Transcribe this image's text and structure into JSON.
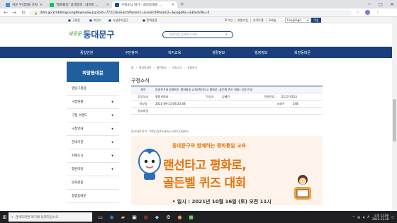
{
  "browser": {
    "tabs": [
      {
        "label": "쉬운 우리말을 쓰자",
        "color": "#4a8bd8"
      },
      {
        "label": "'평화통일' 검색결과 : 네이버 ...",
        "color": "#03c75a"
      },
      {
        "label": "구정소식 읽기 - 희망동대문 ...",
        "color": "#1c4f9c"
      }
    ],
    "new_tab": "+",
    "window_controls": [
      "─",
      "□",
      "✕"
    ],
    "url": "ddm.go.kr/ddm/guungNewsview.jsp?pId=77222&searchParam1=&searchParam2=&pageNo=&blockNo=0",
    "nav_icons": [
      "←",
      "→",
      "↻"
    ]
  },
  "site_util": {
    "left_links": [
      "구청장",
      "보건소",
      "시설관리공단",
      "문화관광"
    ],
    "right_links": [
      "로그인",
      "회원가입",
      "사이트맵",
      "모바일"
    ],
    "language": "Language",
    "go": "이동"
  },
  "header": {
    "logo_a": "새로운",
    "logo_b": "동대문구",
    "search_placeholder": "검색어를 입력해 주세요"
  },
  "gnb": [
    "종합민원",
    "구민참여",
    "복지교육",
    "생활정보",
    "행정정보",
    "희망동대문"
  ],
  "sidebar": {
    "title": "희망동대문",
    "items": [
      {
        "label": "열린구청장",
        "arrow": ""
      },
      {
        "label": "구정현황",
        "arrow": "▼"
      },
      {
        "label": "구정 브랜드",
        "arrow": "▼"
      },
      {
        "label": "구정안내",
        "arrow": "▼"
      },
      {
        "label": "관내기관",
        "arrow": "▼"
      },
      {
        "label": "자매도시",
        "arrow": "▼"
      },
      {
        "label": "열린마당",
        "arrow": "▼"
      },
      {
        "label": "문화관광",
        "arrow": ""
      },
      {
        "label": "청렴동대문",
        "arrow": ""
      }
    ]
  },
  "content": {
    "breadcrumb": [
      "홈",
      "희망동대문",
      "열린마당",
      "구정소식",
      "조회하기"
    ],
    "title": "구정소식",
    "detail": {
      "subject_label": "제목",
      "subject": "동대문구와 함께하는 평화통일 교육(랜선타고 평화로, 골든벨 퀴즈 대회) 신청 안내",
      "dept_label": "담당부서",
      "dept": "행정지원과",
      "author_label": "작성자",
      "author": "김혜진",
      "phone_label": "전화번호",
      "phone": "2127-4313",
      "date_label": "작성일",
      "date": "2021-09-13 09:23:48",
      "views_label": "조회수",
      "views": "248",
      "attach_label": "첨부파일"
    },
    "short_url_label": "링크바로가기 : http://pf.kakao.com/_Dqhhs",
    "poster": {
      "line1": "동대문구와 함께하는 평화통일 교육",
      "line2": "랜선타고 평화로,",
      "line3": "골든벨 퀴즈 대회",
      "line4": "• 일시 : 2021년 10월 16일 (토) 오전 11시"
    }
  },
  "taskbar": {
    "search_placeholder": "검색하려면 여기에 입력하십시오.",
    "time": "오후 12:06",
    "date": "2021-11-28",
    "lang": "A"
  }
}
